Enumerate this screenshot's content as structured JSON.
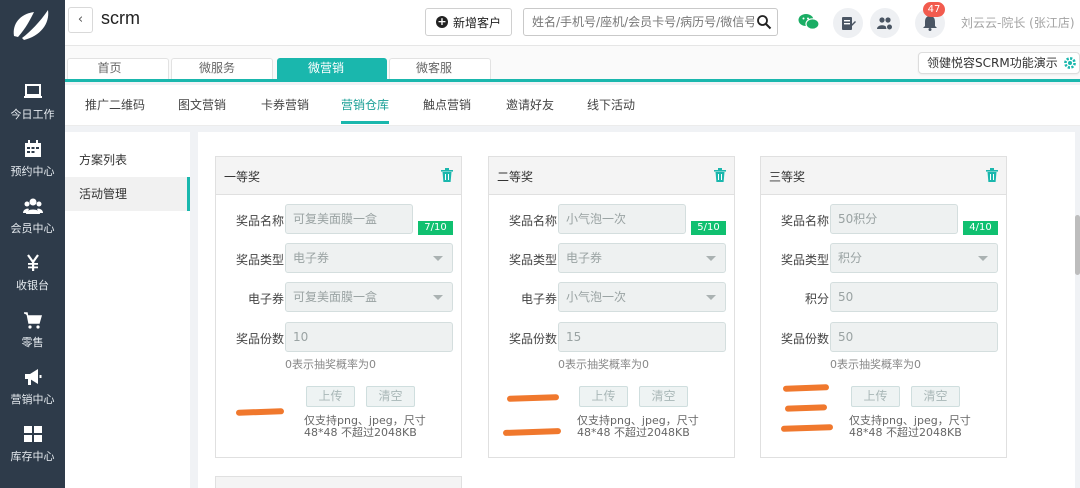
{
  "app": {
    "title": "scrm",
    "back_label": "‹"
  },
  "sidebar": {
    "items": [
      {
        "label": "今日工作",
        "icon": "laptop-icon"
      },
      {
        "label": "预约中心",
        "icon": "calendar-icon"
      },
      {
        "label": "会员中心",
        "icon": "members-icon"
      },
      {
        "label": "收银台",
        "icon": "yen-icon"
      },
      {
        "label": "零售",
        "icon": "cart-icon"
      },
      {
        "label": "营销中心",
        "icon": "megaphone-icon"
      },
      {
        "label": "库存中心",
        "icon": "grid-icon"
      }
    ]
  },
  "header": {
    "add_customer_label": "新增客户",
    "search_placeholder": "姓名/手机号/座机/会员卡号/病历号/微信号",
    "notification_count": "47",
    "user_name": "刘云云-院长 (张江店)"
  },
  "main_tabs": [
    {
      "label": "首页",
      "active": false
    },
    {
      "label": "微服务",
      "active": false
    },
    {
      "label": "微营销",
      "active": true
    },
    {
      "label": "微客服",
      "active": false
    }
  ],
  "notice": {
    "text": "领健悦容SCRM功能演示"
  },
  "sub_nav": [
    {
      "label": "推广二维码",
      "active": false
    },
    {
      "label": "图文营销",
      "active": false
    },
    {
      "label": "卡券营销",
      "active": false
    },
    {
      "label": "营销仓库",
      "active": true
    },
    {
      "label": "触点营销",
      "active": false
    },
    {
      "label": "邀请好友",
      "active": false
    },
    {
      "label": "线下活动",
      "active": false
    }
  ],
  "left_panel": [
    {
      "label": "方案列表",
      "active": false
    },
    {
      "label": "活动管理",
      "active": true
    }
  ],
  "labels": {
    "prize_name": "奖品名称",
    "prize_type": "奖品类型",
    "prize_count": "奖品份数",
    "hint": "0表示抽奖概率为0",
    "upload": "上传",
    "clear": "清空",
    "image_note": "仅支持png、jpeg，尺寸48*48 不超过2048KB"
  },
  "prizes": [
    {
      "title": "一等奖",
      "name": "可复美面膜一盒",
      "counter": "7/10",
      "type": "电子券",
      "third_label": "电子券",
      "third_value": "可复美面膜一盒",
      "third_is_select": true,
      "count": "10"
    },
    {
      "title": "二等奖",
      "name": "小气泡一次",
      "counter": "5/10",
      "type": "电子券",
      "third_label": "电子券",
      "third_value": "小气泡一次",
      "third_is_select": true,
      "count": "15"
    },
    {
      "title": "三等奖",
      "name": "50积分",
      "counter": "4/10",
      "type": "积分",
      "third_label": "积分",
      "third_value": "50",
      "third_is_select": false,
      "count": "50"
    }
  ]
}
